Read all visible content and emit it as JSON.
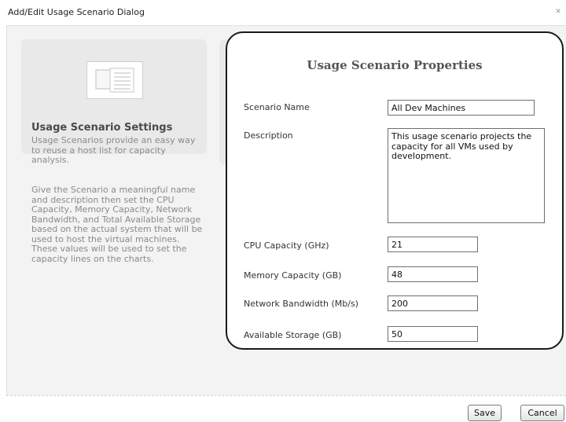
{
  "window": {
    "title": "Add/Edit Usage Scenario Dialog",
    "close_glyph": "✕"
  },
  "left_panel": {
    "icon": "settings-window-icon",
    "title": "Usage Scenario Settings",
    "paragraph1": "Usage Scenarios provide an easy way to reuse a host list for capacity analysis.",
    "paragraph2": "Give the Scenario a meaningful name and description then set the CPU Capacity, Memory Capacity, Network Bandwidth, and Total Available Storage based on the actual system that will be used to host the virtual machines. These values will be used to set the capacity lines on the charts."
  },
  "properties": {
    "title": "Usage Scenario Properties",
    "fields": {
      "scenario_name": {
        "label": "Scenario Name",
        "value": "All Dev Machines"
      },
      "description": {
        "label": "Description",
        "value": "This usage scenario projects the capacity for all VMs used by development."
      },
      "cpu": {
        "label": "CPU Capacity (GHz)",
        "value": "21"
      },
      "memory": {
        "label": "Memory Capacity (GB)",
        "value": "48"
      },
      "network": {
        "label": "Network Bandwidth (Mb/s)",
        "value": "200"
      },
      "storage": {
        "label": "Available Storage (GB)",
        "value": "50"
      }
    }
  },
  "footer": {
    "save_label": "Save",
    "cancel_label": "Cancel"
  },
  "colors": {
    "panel_border": "#1a1a1a",
    "card_bg": "#e9e9e9",
    "dialog_bg": "#f3f3f3"
  }
}
